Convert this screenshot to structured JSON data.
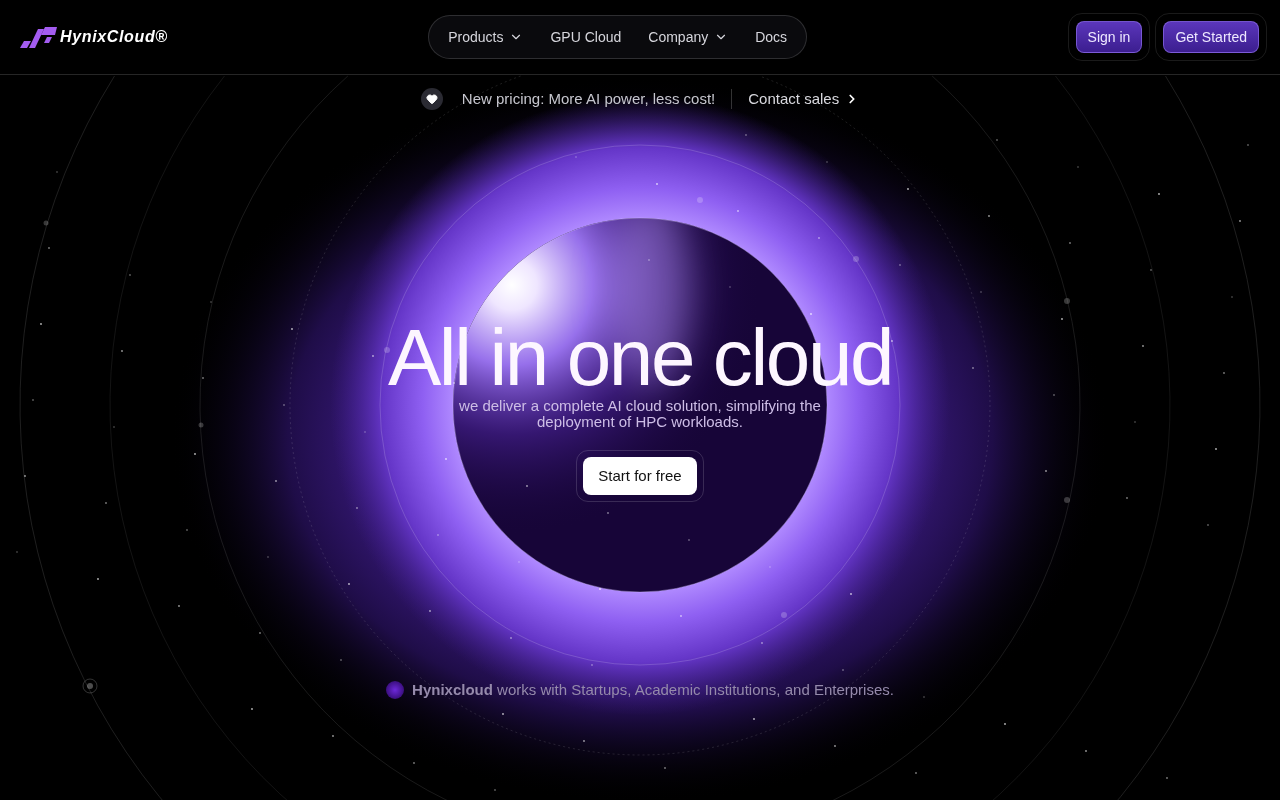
{
  "header": {
    "logo": {
      "text": "HynixCloud®"
    },
    "nav": [
      {
        "label": "Products",
        "dropdown": true
      },
      {
        "label": "GPU Cloud",
        "dropdown": false
      },
      {
        "label": "Company",
        "dropdown": true
      },
      {
        "label": "Docs",
        "dropdown": false
      }
    ],
    "actions": [
      {
        "label": "Sign in"
      },
      {
        "label": "Get Started"
      }
    ]
  },
  "announcement": {
    "text": "New pricing: More AI power, less cost!",
    "link": "Contact sales"
  },
  "hero": {
    "title": "All in one cloud",
    "subtitle": "we deliver a complete AI cloud solution, simplifying the deployment of HPC workloads.",
    "cta": "Start for free"
  },
  "footer_note": "**Hynixcloud** works with Startups, Academic Institutions, and Enterprises."
}
